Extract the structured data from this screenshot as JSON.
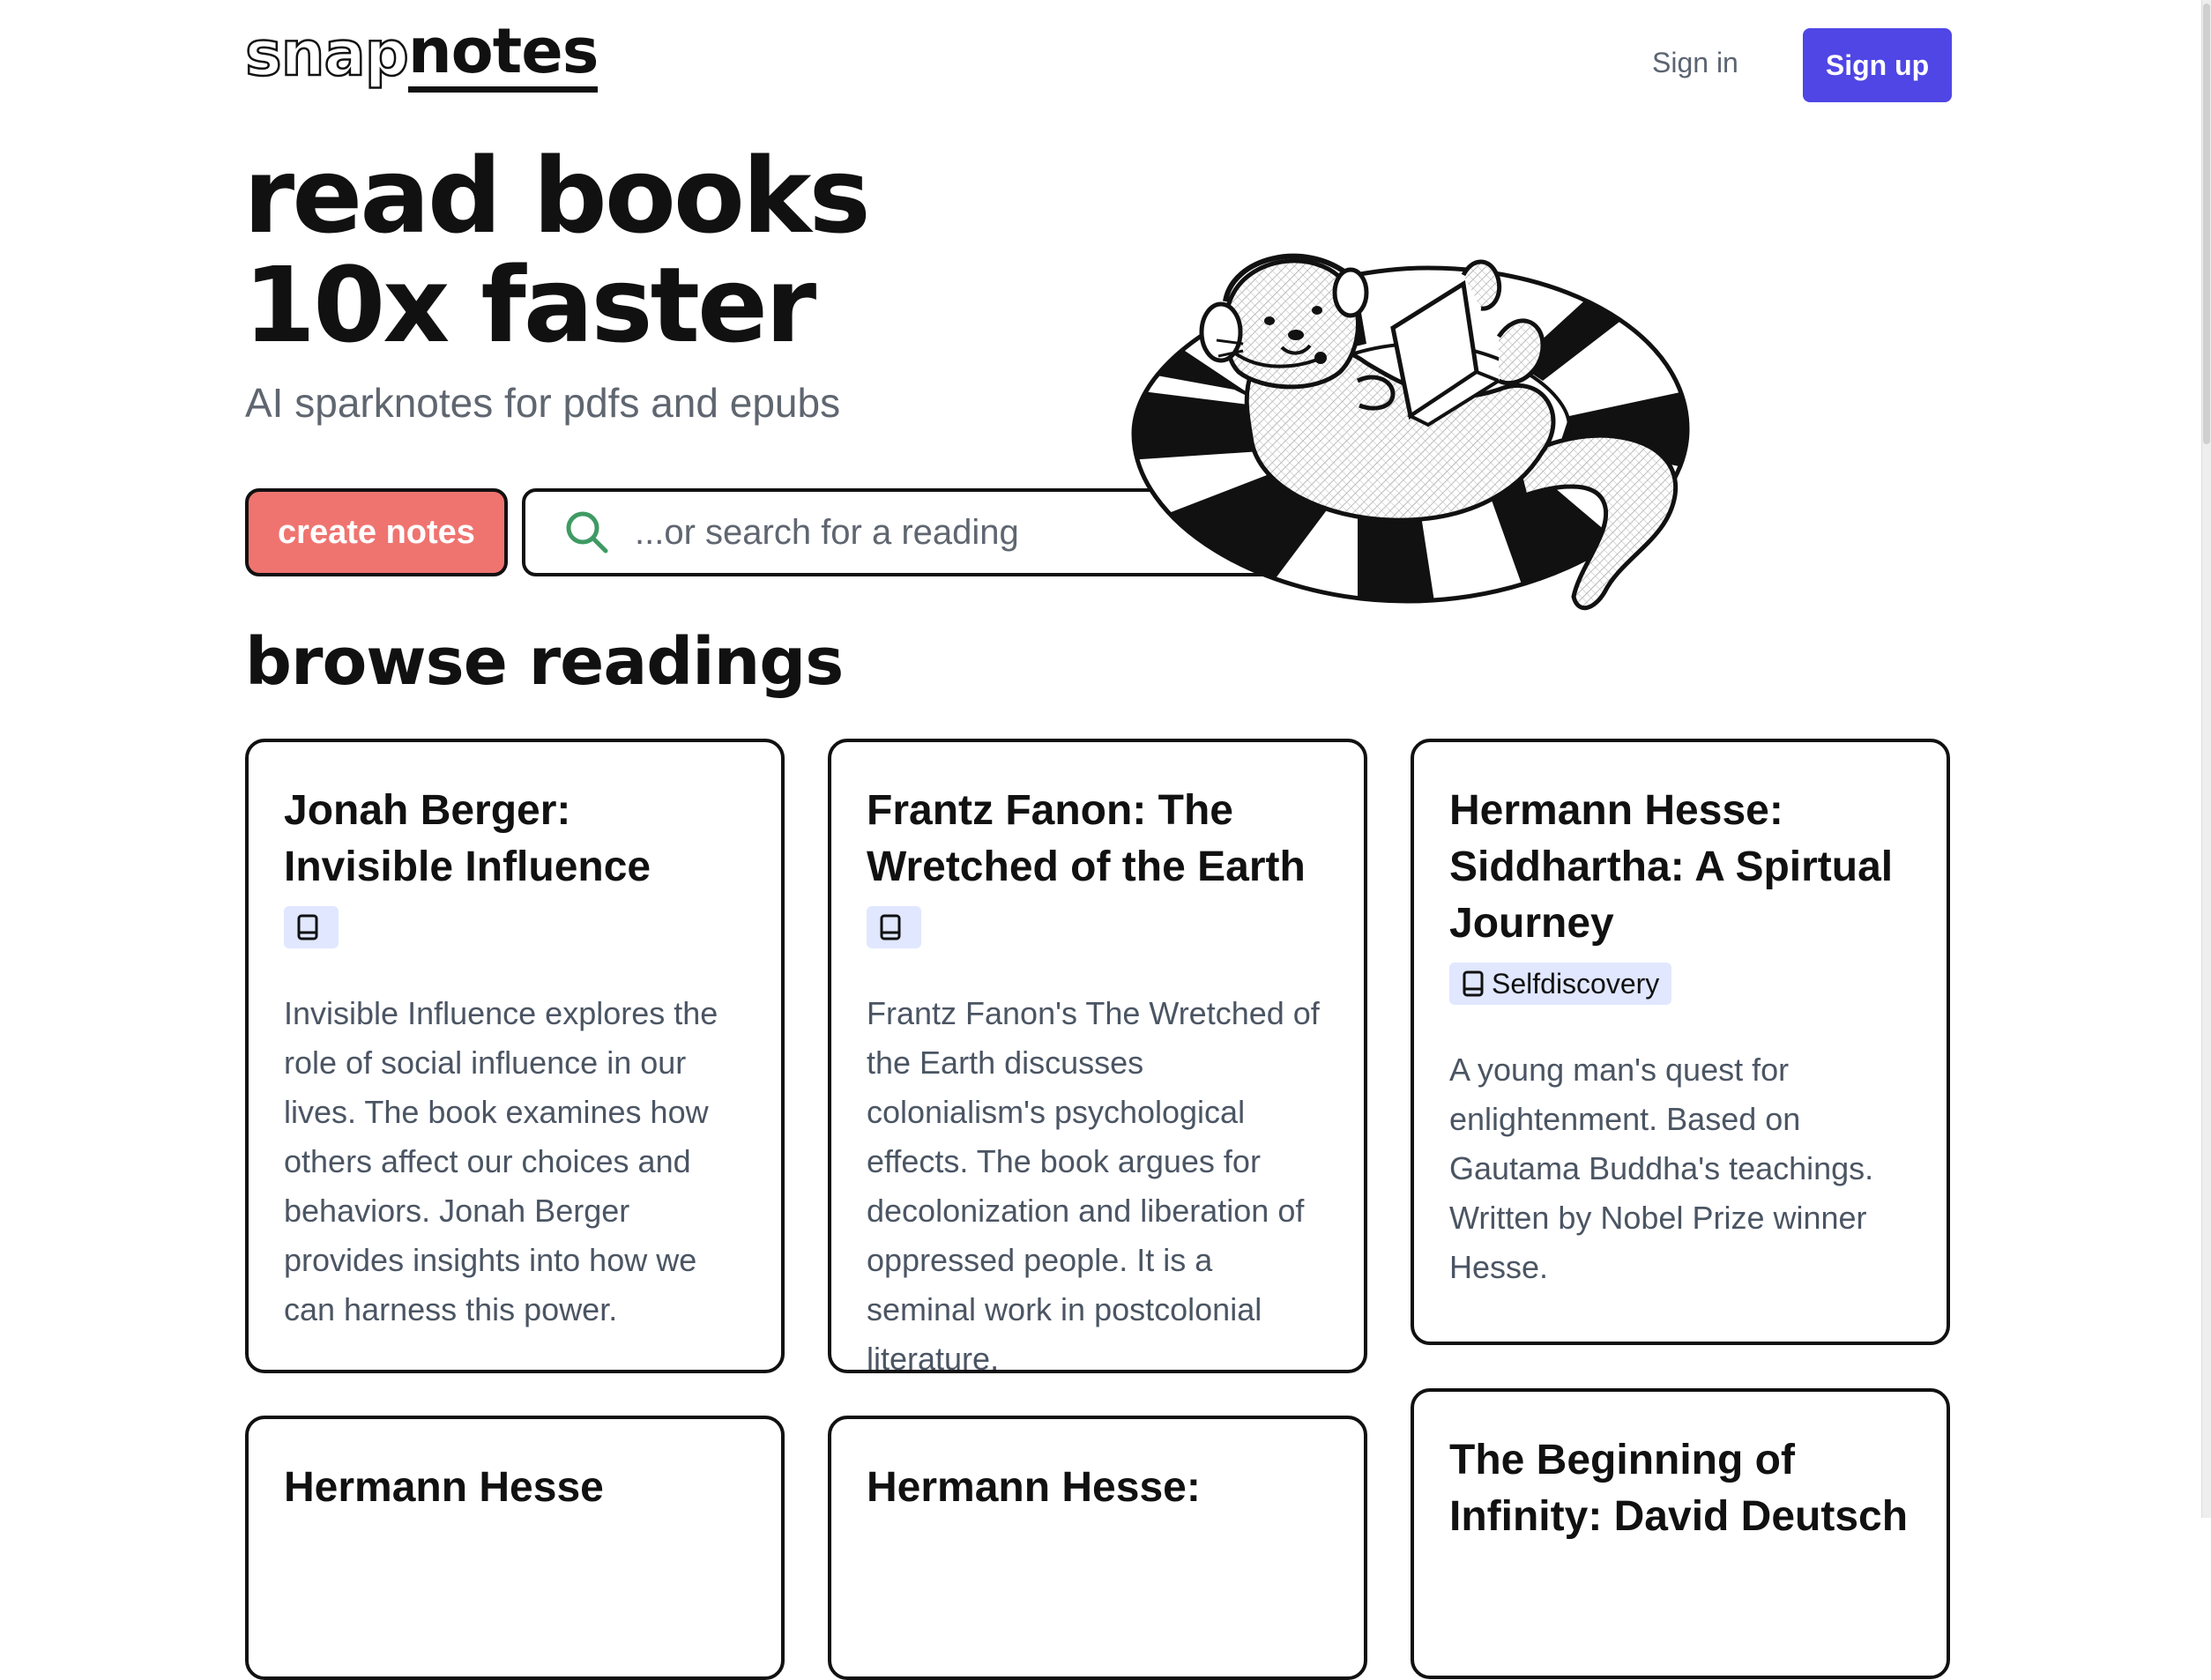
{
  "header": {
    "logo_part1": "snap",
    "logo_part2": "notes",
    "signin_label": "Sign in",
    "signup_label": "Sign up"
  },
  "hero": {
    "title_line1": "read books",
    "title_line2": "10x faster",
    "subtitle": "AI sparknotes for pdfs and epubs",
    "create_label": "create notes",
    "search_placeholder": "...or search for a reading"
  },
  "browse": {
    "title": "browse readings",
    "cards": [
      {
        "title": "Jonah Berger: Invisible Influence",
        "tag": "",
        "description": "Invisible Influence explores the role of social influence in our lives. The book examines how others affect our choices and behaviors. Jonah Berger provides insights into how we can harness this power."
      },
      {
        "title": "Frantz Fanon: The Wretched of the Earth",
        "tag": "",
        "description": "Frantz Fanon's The Wretched of the Earth discusses colonialism's psychological effects. The book argues for decolonization and liberation of oppressed people. It is a seminal work in postcolonial literature."
      },
      {
        "title": "Hermann Hesse: Siddhartha: A Spirtual Journey",
        "tag": "Selfdiscovery",
        "description": "A young man's quest for enlightenment. Based on Gautama Buddha's teachings. Written by Nobel Prize winner Hesse."
      },
      {
        "title": "Hermann Hesse"
      },
      {
        "title": "Hermann Hesse:"
      },
      {
        "title": "The Beginning of Infinity: David Deutsch"
      }
    ]
  },
  "colors": {
    "brand_indigo": "#4f46e5",
    "create_red": "#ef7470",
    "tag_bg": "#e0e7ff",
    "search_icon_green": "#3f9a63"
  },
  "icons": {
    "search": "search-icon",
    "book": "book-icon"
  }
}
